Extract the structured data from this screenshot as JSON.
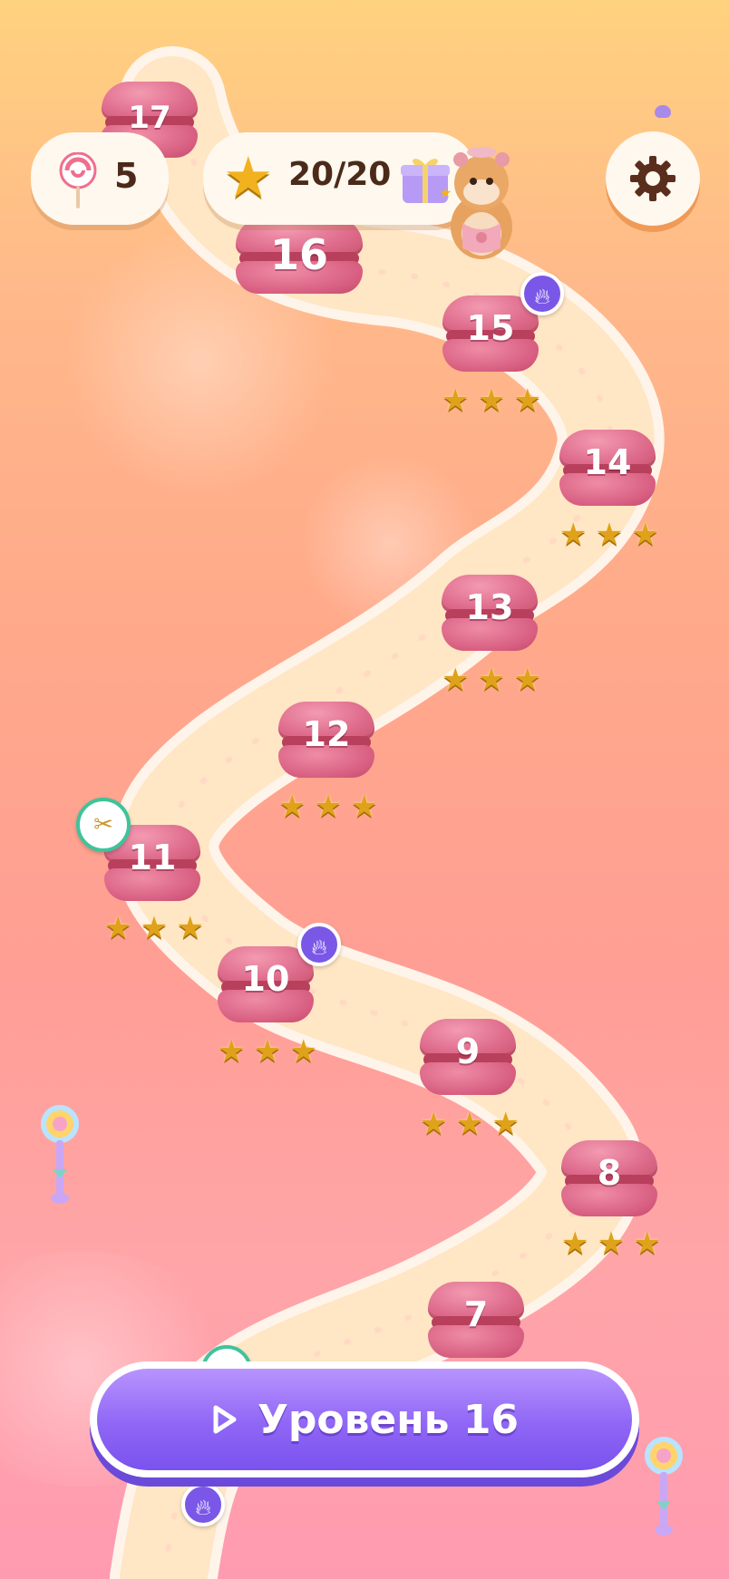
{
  "hud": {
    "lollipops": "5",
    "stars": "20/20"
  },
  "play_button": {
    "label": "Уровень 16"
  },
  "levels": [
    {
      "num": "7",
      "stars": 0,
      "badge": null
    },
    {
      "num": "8",
      "stars": 3,
      "badge": null
    },
    {
      "num": "9",
      "stars": 3,
      "badge": null
    },
    {
      "num": "10",
      "stars": 3,
      "badge": "boost"
    },
    {
      "num": "11",
      "stars": 3,
      "badge": "tongs"
    },
    {
      "num": "12",
      "stars": 3,
      "badge": null
    },
    {
      "num": "13",
      "stars": 3,
      "badge": null
    },
    {
      "num": "14",
      "stars": 3,
      "badge": null
    },
    {
      "num": "15",
      "stars": 3,
      "badge": "boost"
    },
    {
      "num": "16",
      "stars": 0,
      "badge": null,
      "current": true
    },
    {
      "num": "17",
      "stars": 0,
      "badge": null
    }
  ],
  "icons": {
    "lollipop": "lollipop-icon",
    "star": "star-icon",
    "gift": "gift-icon",
    "settings": "gear-icon",
    "play": "play-icon",
    "boost": "flame-icon",
    "tongs": "tongs-icon",
    "mascot": "hamster-mascot"
  },
  "colors": {
    "accent": "#8f66f5",
    "macaron": "#de6b8c",
    "star": "#e0a21a",
    "boost_badge": "#7a57e6",
    "tongs_badge_ring": "#3fc39a"
  }
}
